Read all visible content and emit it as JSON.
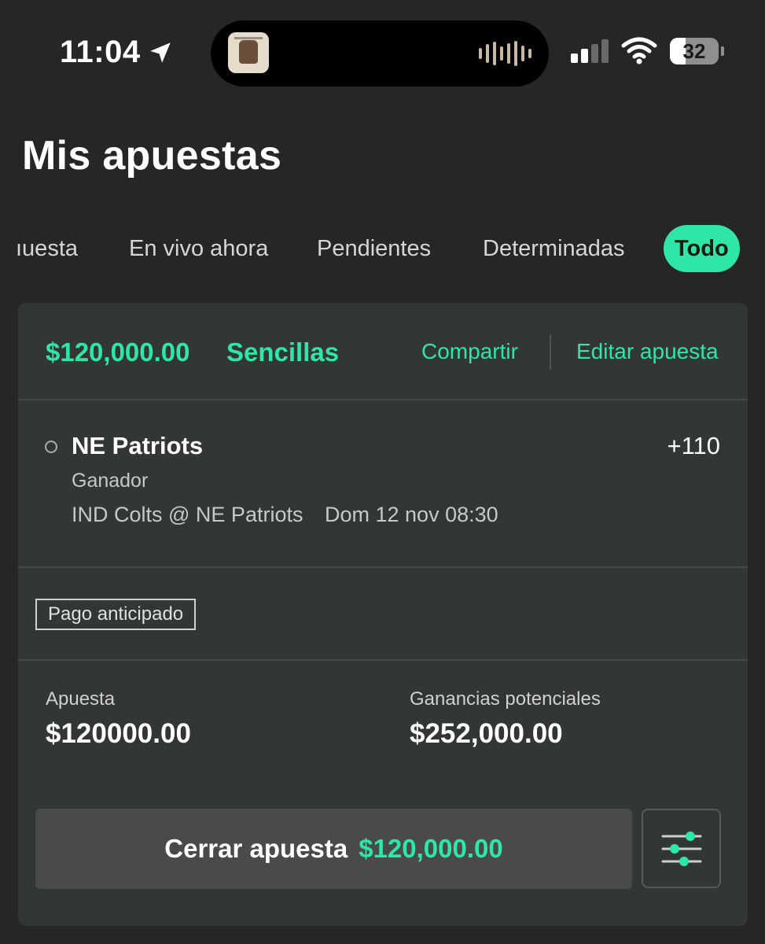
{
  "status_bar": {
    "time": "11:04",
    "battery": "32",
    "battery_level": 0.32,
    "icons": [
      "location-arrow-icon",
      "waveform-icon",
      "signal-icon",
      "wifi-icon",
      "battery-icon"
    ]
  },
  "page": {
    "title": "Mis apuestas"
  },
  "tabs": [
    {
      "label": "ıuesta"
    },
    {
      "label": "En vivo ahora"
    },
    {
      "label": "Pendientes"
    },
    {
      "label": "Determinadas"
    },
    {
      "label": "Todo",
      "active": true
    }
  ],
  "bet": {
    "stake_header": "$120,000.00",
    "type": "Sencillas",
    "share_label": "Compartir",
    "edit_label": "Editar apuesta",
    "selection": {
      "team": "NE Patriots",
      "odds": "+110",
      "market": "Ganador",
      "matchup": "IND Colts @ NE Patriots",
      "event_time": "Dom 12 nov 08:30"
    },
    "badge": "Pago anticipado",
    "stake_label": "Apuesta",
    "stake_value": "$120000.00",
    "payout_label": "Ganancias potenciales",
    "payout_value": "$252,000.00",
    "cashout_label": "Cerrar apuesta",
    "cashout_amount": "$120,000.00"
  },
  "colors": {
    "accent": "#2ee6a6",
    "background": "#262626",
    "card": "#323735"
  }
}
